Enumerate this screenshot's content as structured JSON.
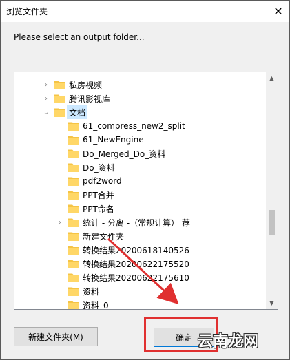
{
  "window": {
    "title": "浏览文件夹",
    "close_glyph": "✕"
  },
  "prompt": "Please select an output folder...",
  "tree": {
    "items": [
      {
        "label": "私房视频",
        "expander": "›"
      },
      {
        "label": "腾讯影视库",
        "expander": "›"
      },
      {
        "label": "文档",
        "expander": "⌄",
        "selected": true
      },
      {
        "label": "61_compress_new2_split"
      },
      {
        "label": "61_NewEngine"
      },
      {
        "label": "Do_Merged_Do_资料"
      },
      {
        "label": "Do_资料"
      },
      {
        "label": "pdf2word"
      },
      {
        "label": "PPT合并"
      },
      {
        "label": "PPT命名"
      },
      {
        "label": "统计 - 分离 -（常规计算） 荐",
        "expander": "›"
      },
      {
        "label": "新建文件夹"
      },
      {
        "label": "转换结果20200618140526"
      },
      {
        "label": "转换结果20200622175520"
      },
      {
        "label": "转换结果20200622175610"
      },
      {
        "label": "资料"
      },
      {
        "label": "资料_0"
      }
    ]
  },
  "buttons": {
    "new_folder": "新建文件夹(M)",
    "ok": "确定"
  },
  "watermark": "云南龙网",
  "colors": {
    "folder": "#f5c445",
    "selection": "#cce8ff",
    "annotation": "#e03030"
  }
}
